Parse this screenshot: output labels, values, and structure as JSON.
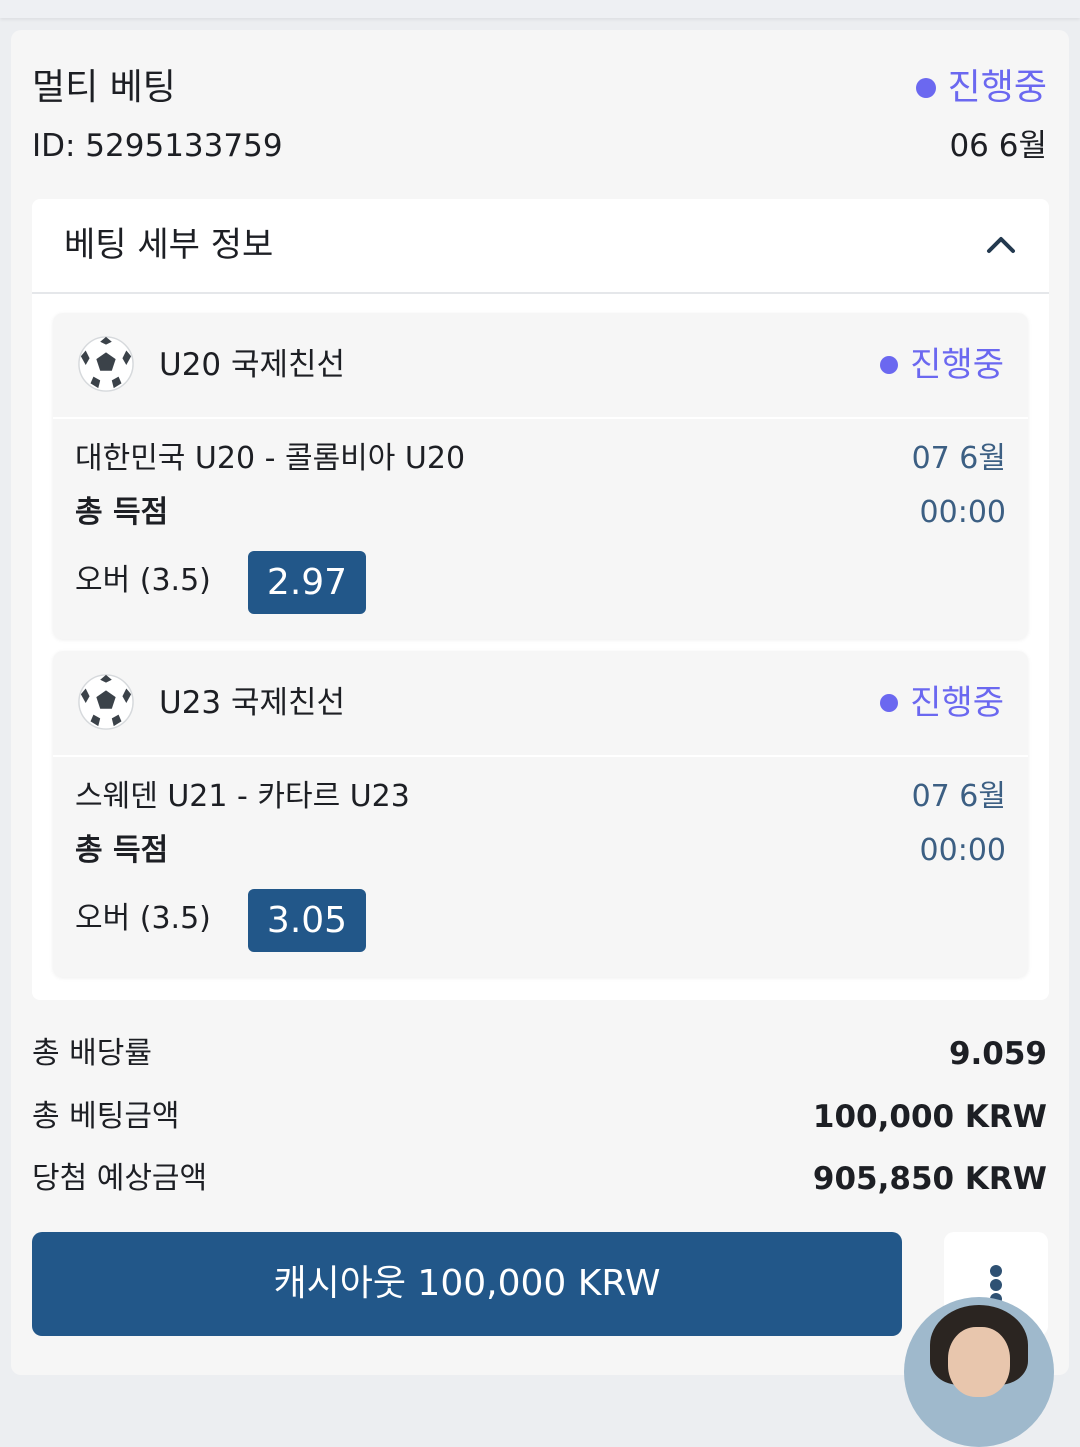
{
  "bet": {
    "title": "멀티 베팅",
    "id_text": "ID: 5295133759",
    "status": "진행중",
    "date": "06 6월"
  },
  "details": {
    "title": "베팅 세부 정보",
    "toggle_icon": "chevron-up-icon"
  },
  "legs": [
    {
      "sport_icon": "soccer-ball-icon",
      "league": "U20 국제친선",
      "status": "진행중",
      "match": "대한민국 U20 - 콜롬비아 U20",
      "date": "07 6월",
      "market": "총 득점",
      "time": "00:00",
      "pick": "오버 (3.5)",
      "odds": "2.97"
    },
    {
      "sport_icon": "soccer-ball-icon",
      "league": "U23 국제친선",
      "status": "진행중",
      "match": "스웨덴 U21 - 카타르 U23",
      "date": "07 6월",
      "market": "총 득점",
      "time": "00:00",
      "pick": "오버 (3.5)",
      "odds": "3.05"
    }
  ],
  "summary": {
    "total_odds_label": "총 배당률",
    "total_odds": "9.059",
    "stake_label": "총 베팅금액",
    "stake": "100,000 KRW",
    "potential_label": "당첨 예상금액",
    "potential": "905,850 KRW"
  },
  "actions": {
    "cashout_label": "캐시아웃 100,000 KRW",
    "more_icon": "more-vertical-icon"
  },
  "colors": {
    "accent_status": "#6b68f0",
    "primary_button": "#225789",
    "date_text": "#3c5f83"
  }
}
